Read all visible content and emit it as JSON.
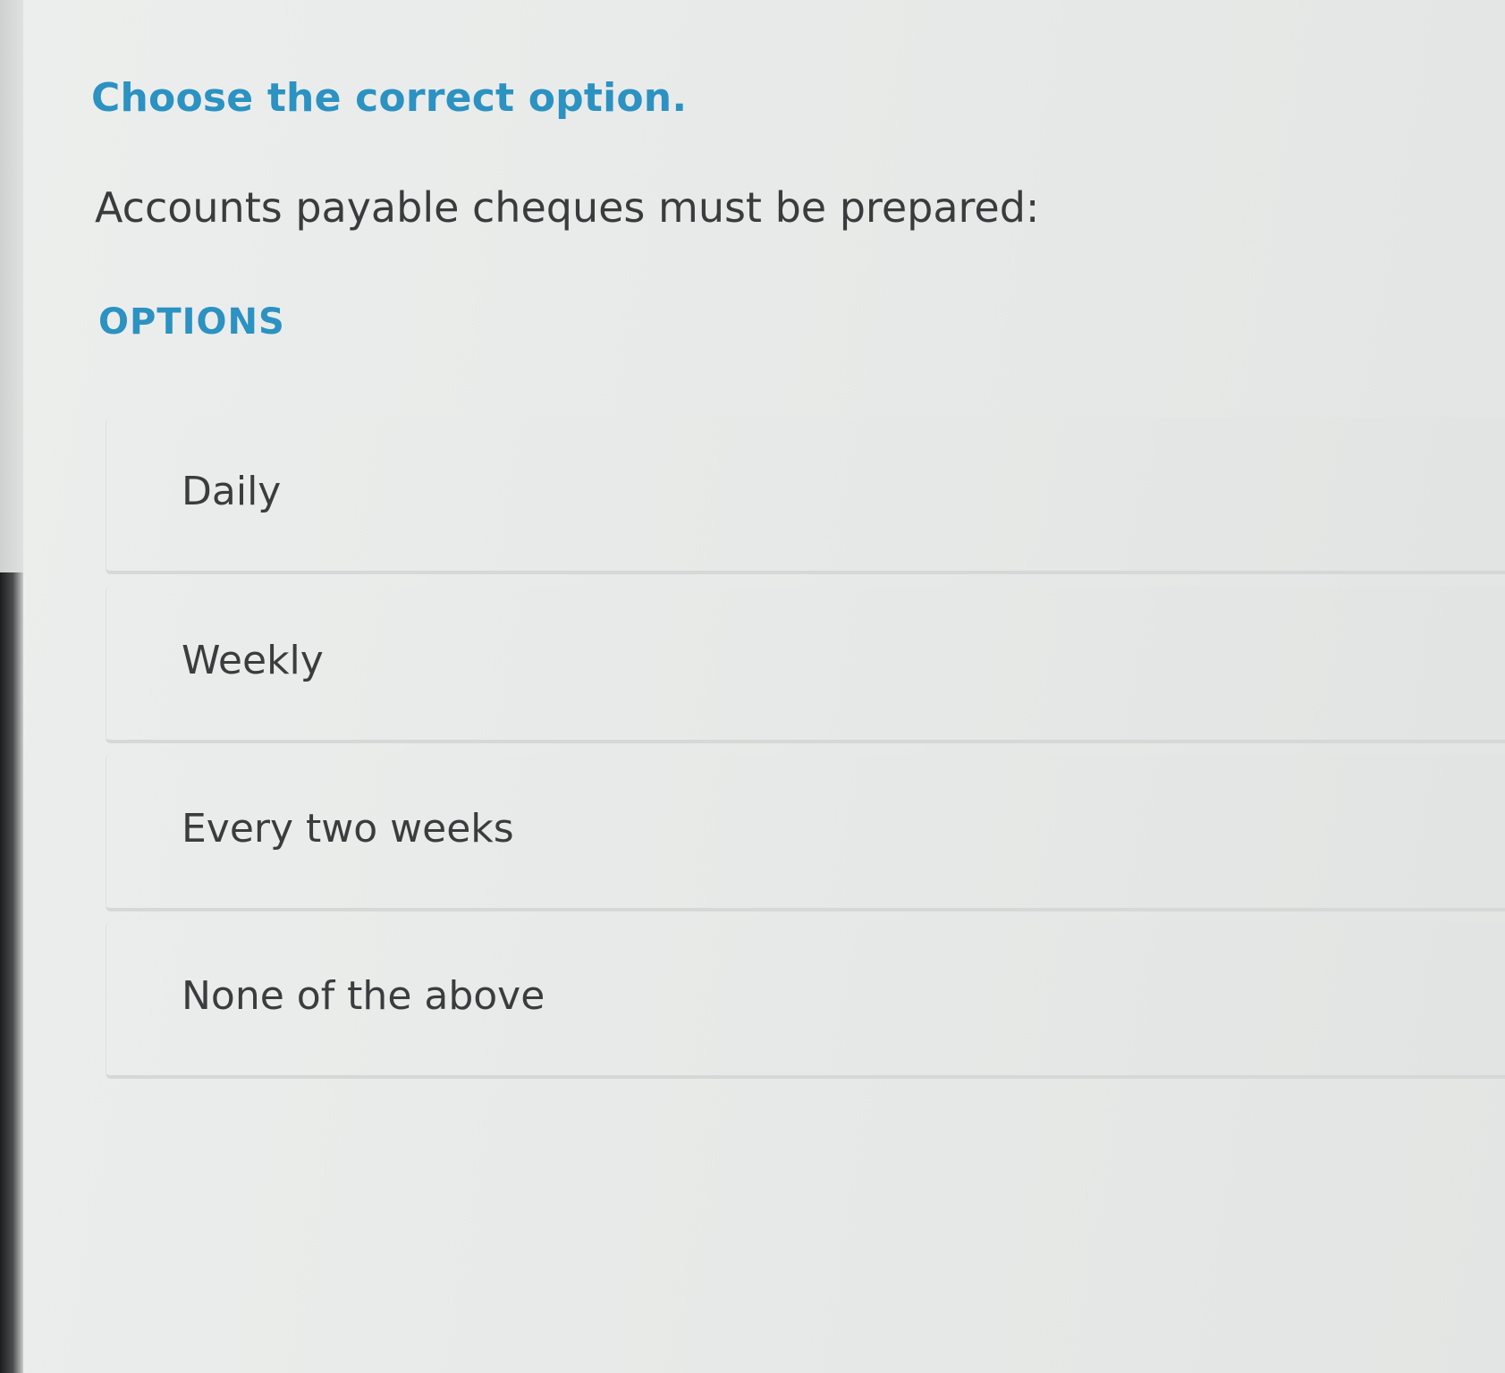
{
  "question": {
    "instruction": "Choose the correct option.",
    "prompt": "Accounts payable cheques must be prepared:",
    "options_heading": "OPTIONS",
    "options": [
      {
        "label": "Daily"
      },
      {
        "label": "Weekly"
      },
      {
        "label": "Every two weeks"
      },
      {
        "label": "None of the above"
      }
    ]
  },
  "colors": {
    "accent": "#2b92c2",
    "text": "#3a3b3c",
    "background": "#e9ebea"
  }
}
